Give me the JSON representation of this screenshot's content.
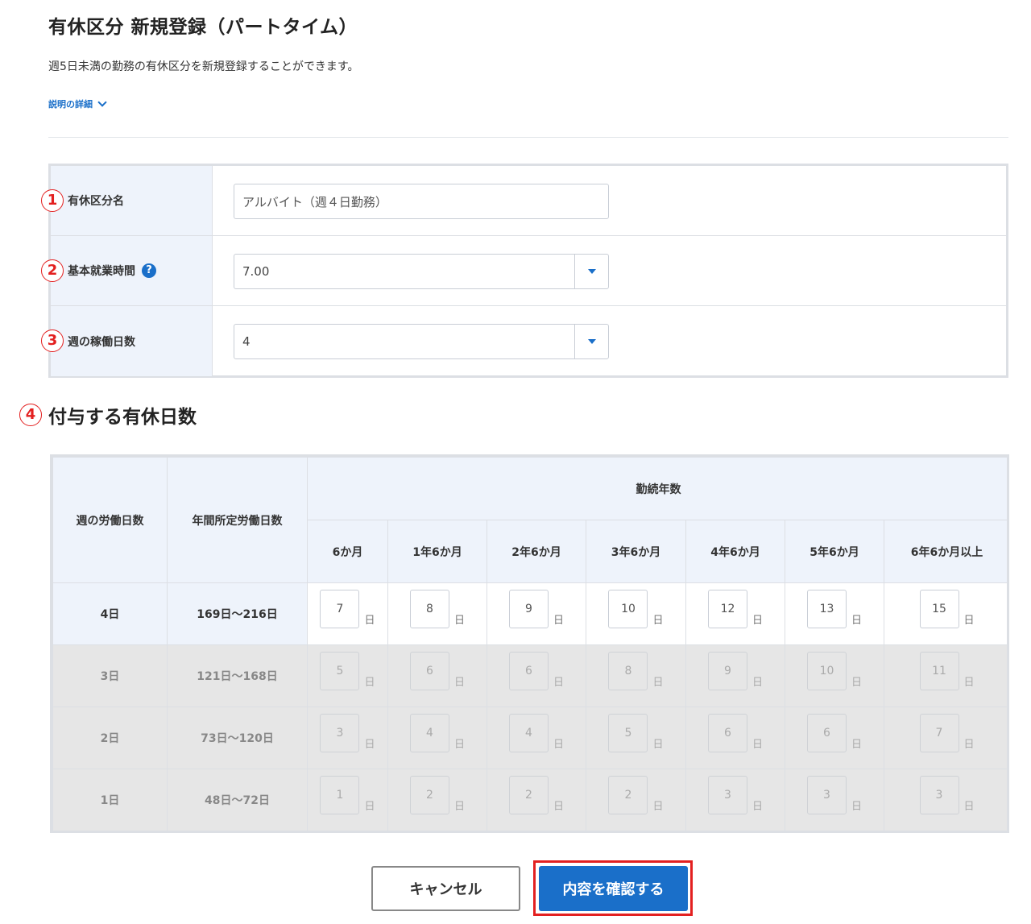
{
  "header": {
    "title": "有休区分 新規登録（パートタイム）",
    "description": "週5日未満の勤務の有休区分を新規登録することができます。",
    "detail_link": "説明の詳細"
  },
  "markers": [
    "1",
    "2",
    "3",
    "4"
  ],
  "form": {
    "name_label": "有休区分名",
    "name_value": "アルバイト（週４日勤務）",
    "hours_label": "基本就業時間",
    "hours_help": "?",
    "hours_value": "7.00",
    "days_label": "週の稼働日数",
    "days_value": "4"
  },
  "grant_section": {
    "title": "付与する有休日数",
    "col_weekdays": "週の労働日数",
    "col_annual": "年間所定労働日数",
    "col_years": "勤続年数",
    "year_headers": [
      "6か月",
      "1年6か月",
      "2年6か月",
      "3年6か月",
      "4年6か月",
      "5年6か月",
      "6年6か月以上"
    ],
    "unit": "日",
    "rows": [
      {
        "days": "4日",
        "range": "169日～216日",
        "values": [
          "7",
          "8",
          "9",
          "10",
          "12",
          "13",
          "15"
        ],
        "active": true
      },
      {
        "days": "3日",
        "range": "121日～168日",
        "values": [
          "5",
          "6",
          "6",
          "8",
          "9",
          "10",
          "11"
        ],
        "active": false
      },
      {
        "days": "2日",
        "range": "73日～120日",
        "values": [
          "3",
          "4",
          "4",
          "5",
          "6",
          "6",
          "7"
        ],
        "active": false
      },
      {
        "days": "1日",
        "range": "48日～72日",
        "values": [
          "1",
          "2",
          "2",
          "2",
          "3",
          "3",
          "3"
        ],
        "active": false
      }
    ]
  },
  "buttons": {
    "cancel": "キャンセル",
    "confirm": "内容を確認する"
  },
  "colors": {
    "accent": "#1a6fc9",
    "marker": "#e32020",
    "label_bg": "#eef3fb",
    "disabled_bg": "#e6e6e6"
  }
}
